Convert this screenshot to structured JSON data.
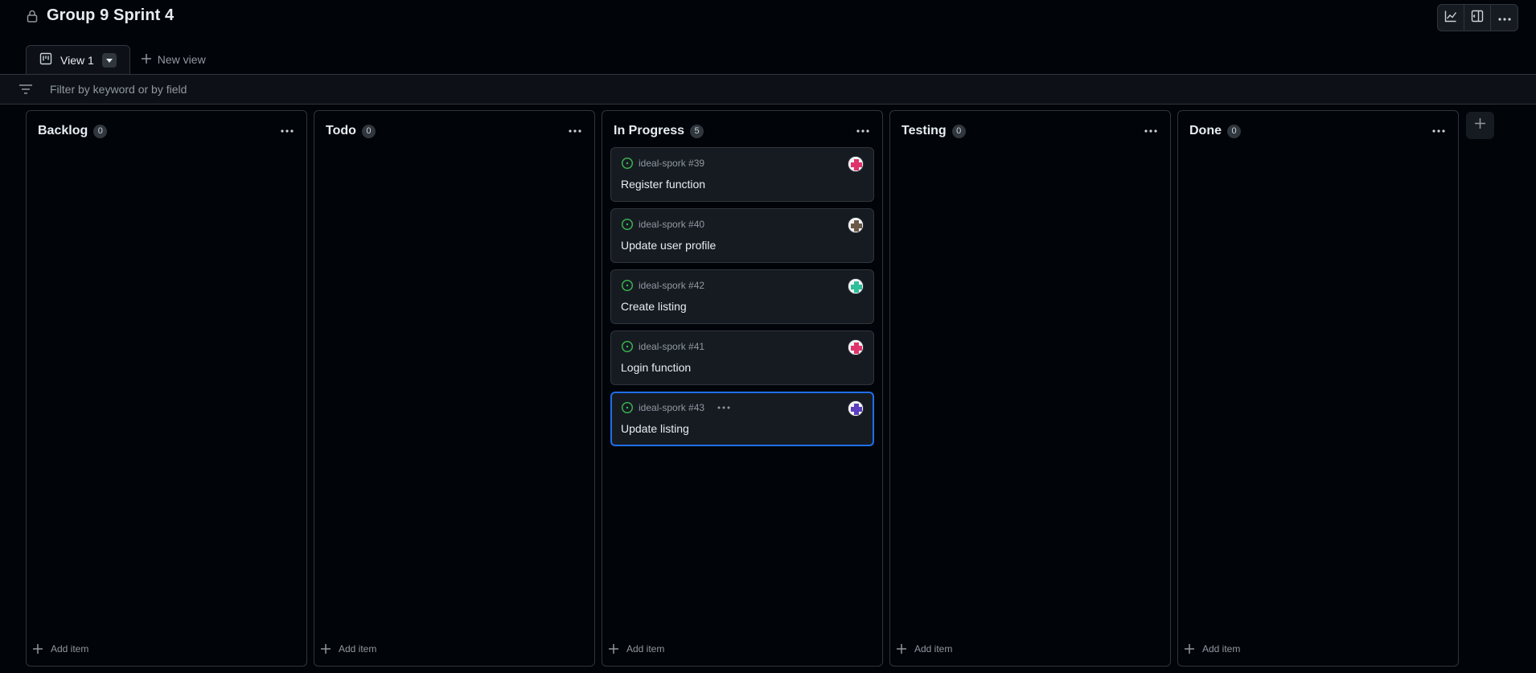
{
  "project": {
    "title": "Group 9 Sprint 4"
  },
  "header_actions": [
    {
      "icon": "insights-icon"
    },
    {
      "icon": "side-panel-icon"
    },
    {
      "icon": "more-icon"
    }
  ],
  "views": {
    "active_tab": "View 1",
    "new_view_label": "New view"
  },
  "filter": {
    "placeholder": "Filter by keyword or by field",
    "value": ""
  },
  "columns": [
    {
      "name": "Backlog",
      "count": "0",
      "add_label": "Add item",
      "cards": []
    },
    {
      "name": "Todo",
      "count": "0",
      "add_label": "Add item",
      "cards": []
    },
    {
      "name": "In Progress",
      "count": "5",
      "add_label": "Add item",
      "cards": [
        {
          "ref": "ideal-spork #39",
          "title": "Register function",
          "avatar_color": "#e0336b",
          "selected": false
        },
        {
          "ref": "ideal-spork #40",
          "title": "Update user profile",
          "avatar_color": "#6b5a48",
          "selected": false
        },
        {
          "ref": "ideal-spork #42",
          "title": "Create listing",
          "avatar_color": "#2fbf9b",
          "selected": false
        },
        {
          "ref": "ideal-spork #41",
          "title": "Login function",
          "avatar_color": "#e0336b",
          "selected": false
        },
        {
          "ref": "ideal-spork #43",
          "title": "Update listing",
          "avatar_color": "#5b3fbf",
          "selected": true
        }
      ]
    },
    {
      "name": "Testing",
      "count": "0",
      "add_label": "Add item",
      "cards": []
    },
    {
      "name": "Done",
      "count": "0",
      "add_label": "Add item",
      "cards": []
    }
  ],
  "colors": {
    "background": "#010409",
    "panel": "#161b22",
    "border": "#30363d",
    "accent": "#1f6feb",
    "open_issue": "#3fb950",
    "muted_text": "#9198a1"
  }
}
